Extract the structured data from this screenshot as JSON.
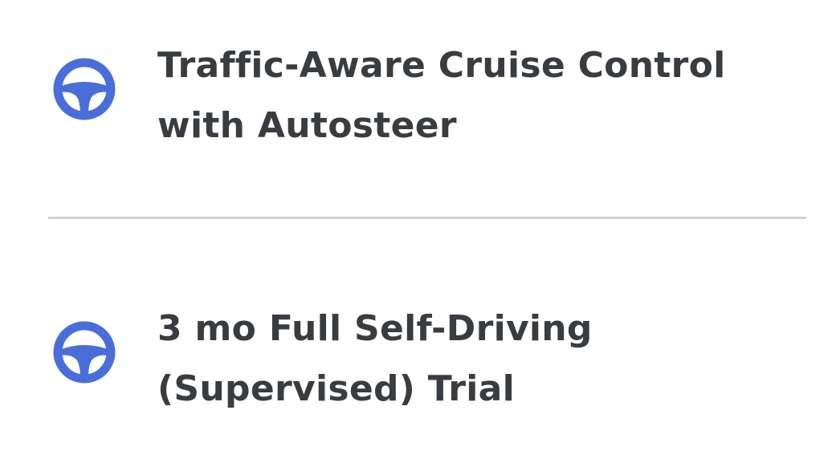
{
  "features": [
    {
      "icon": "steering-wheel-icon",
      "line1": "Traffic-Aware Cruise Control",
      "line2": "with Autosteer"
    },
    {
      "icon": "steering-wheel-icon",
      "line1": "3 mo Full Self-Driving",
      "line2": "(Supervised) Trial"
    }
  ],
  "colors": {
    "icon": "#4a6ed9",
    "text": "#393c41",
    "divider": "#d0d1d2",
    "background": "#ffffff"
  }
}
